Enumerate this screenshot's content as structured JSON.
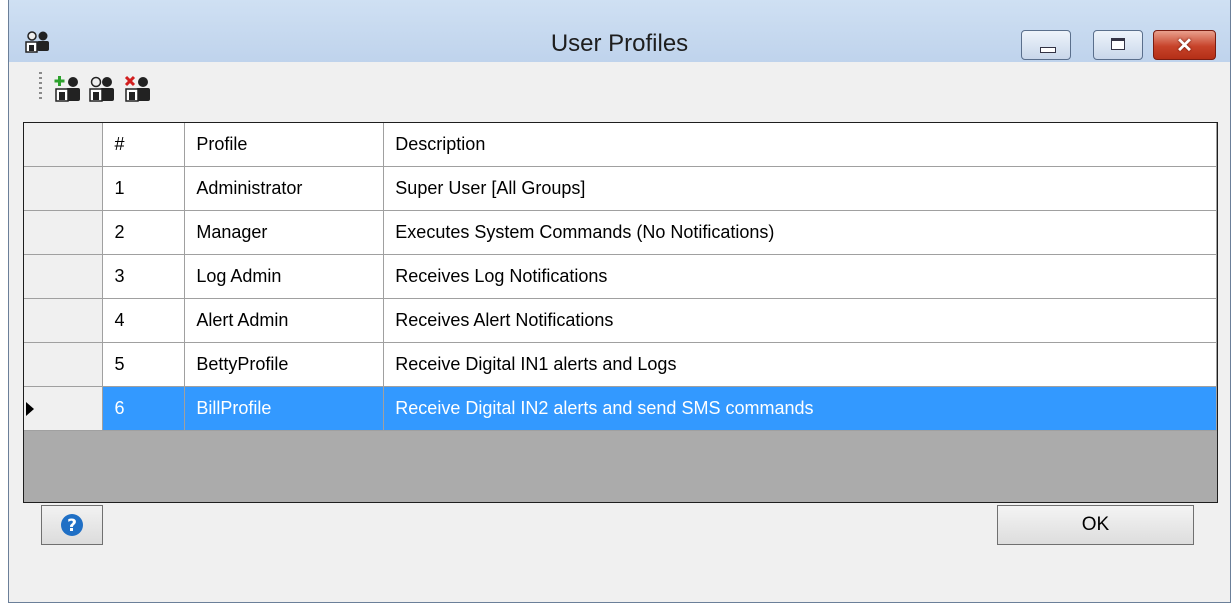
{
  "window": {
    "title": "User Profiles"
  },
  "toolbar": {
    "buttons": [
      {
        "icon": "add-user-icon"
      },
      {
        "icon": "user-icon"
      },
      {
        "icon": "delete-user-icon"
      }
    ]
  },
  "grid": {
    "columns": [
      "#",
      "Profile",
      "Description"
    ],
    "rows": [
      {
        "num": "1",
        "profile": "Administrator",
        "description": "Super User [All Groups]"
      },
      {
        "num": "2",
        "profile": "Manager",
        "description": "Executes System Commands (No Notifications)"
      },
      {
        "num": "3",
        "profile": "Log Admin",
        "description": "Receives Log Notifications"
      },
      {
        "num": "4",
        "profile": "Alert Admin",
        "description": "Receives Alert Notifications"
      },
      {
        "num": "5",
        "profile": "BettyProfile",
        "description": "Receive Digital IN1 alerts and Logs"
      },
      {
        "num": "6",
        "profile": "BillProfile",
        "description": "Receive Digital IN2 alerts and send SMS commands"
      }
    ],
    "selected_row": 6,
    "selection_color": "#3399ff"
  },
  "footer": {
    "ok_label": "OK",
    "help_icon": "help-icon"
  }
}
